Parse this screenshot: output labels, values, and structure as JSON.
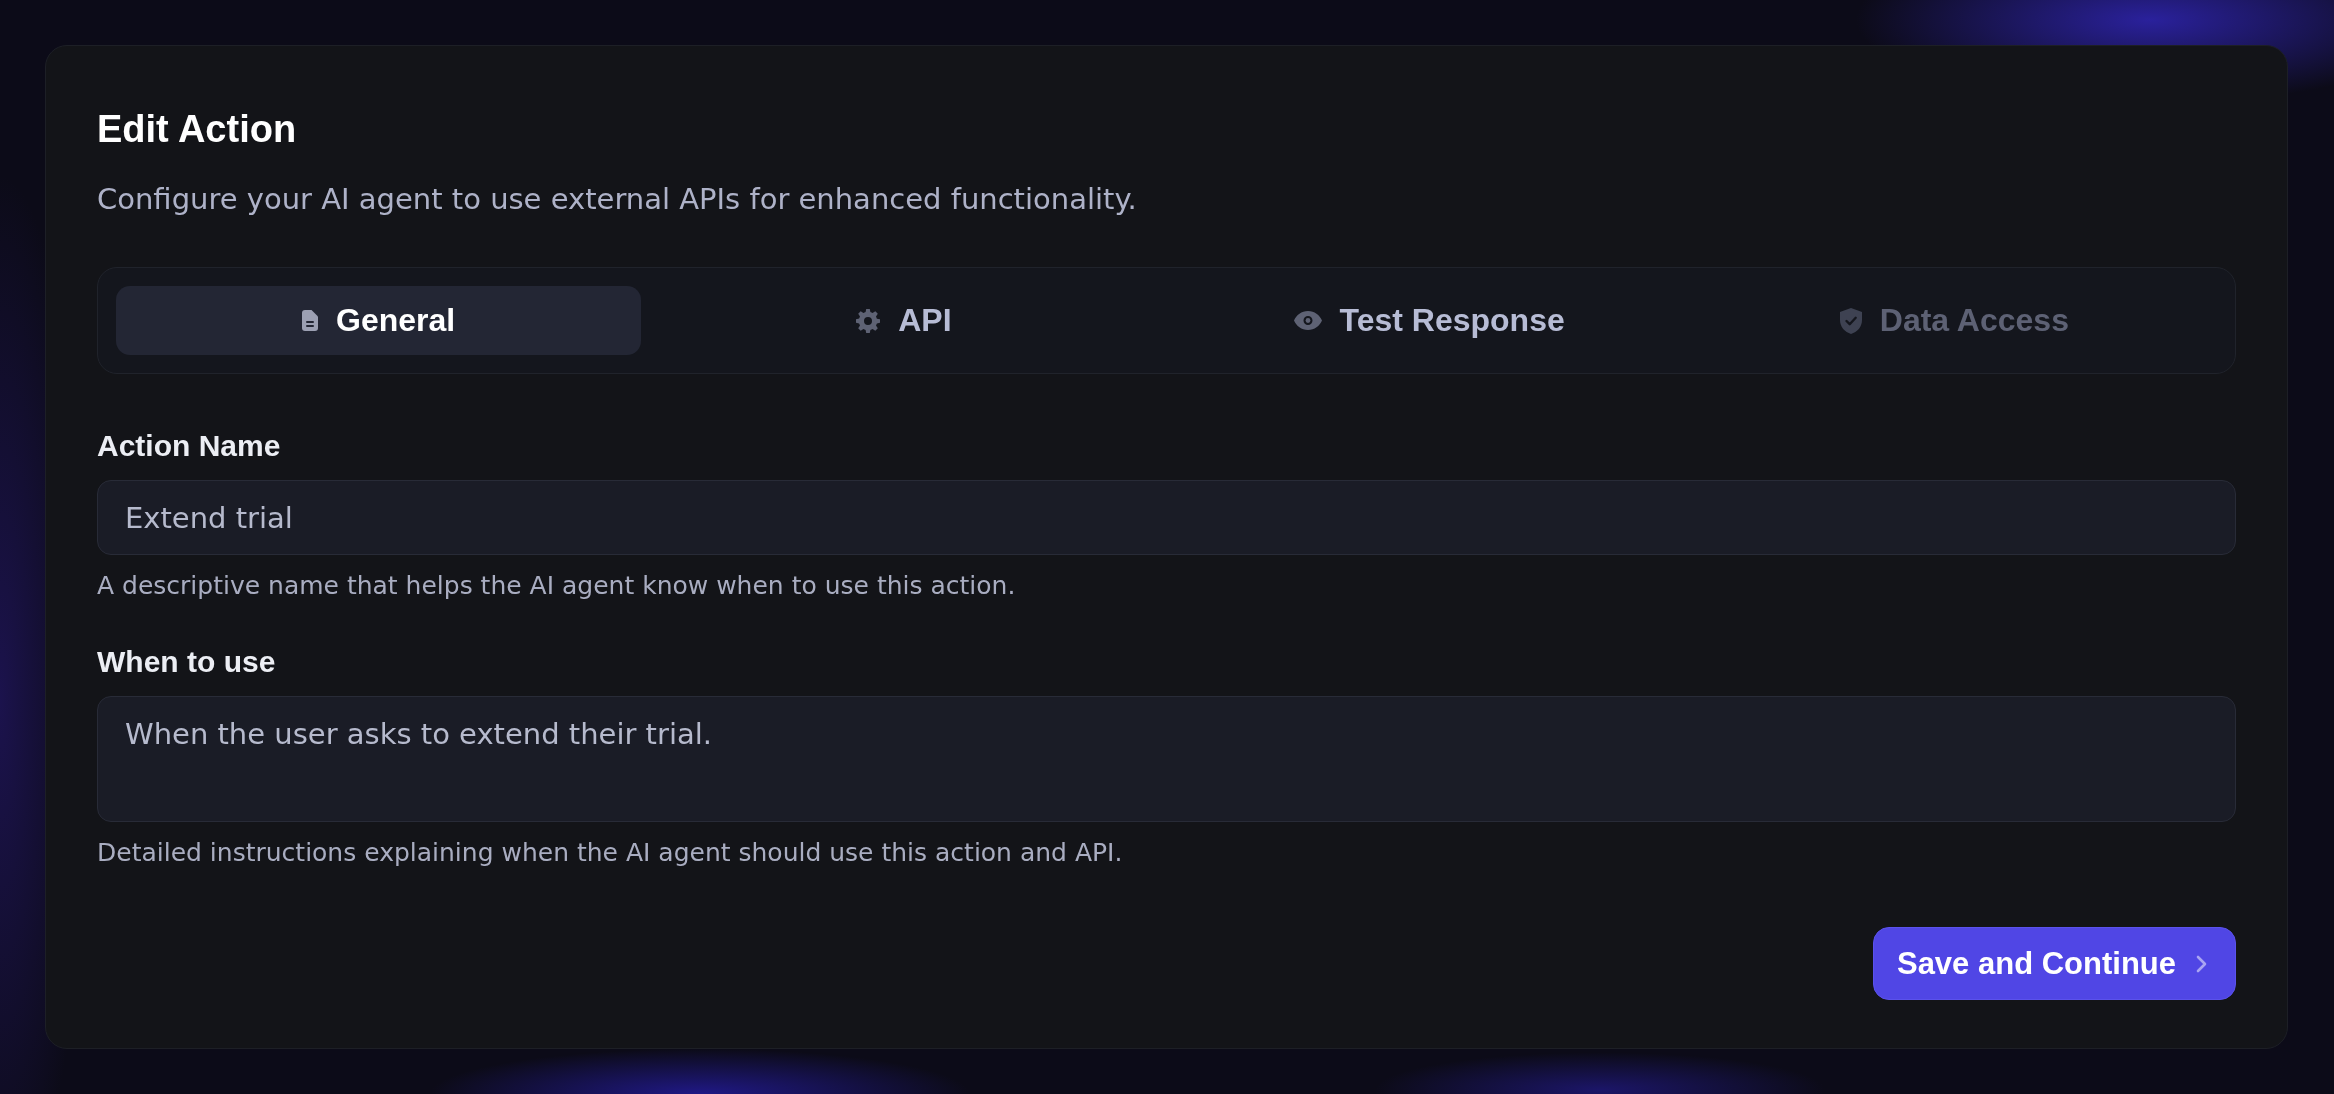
{
  "dialog": {
    "title": "Edit Action",
    "subtitle": "Configure your AI agent to use external APIs for enhanced functionality."
  },
  "tabs": [
    {
      "label": "General",
      "selected": true,
      "disabled": false
    },
    {
      "label": "API",
      "selected": false,
      "disabled": false
    },
    {
      "label": "Test Response",
      "selected": false,
      "disabled": false
    },
    {
      "label": "Data Access",
      "selected": false,
      "disabled": true
    }
  ],
  "fields": [
    {
      "kind": "input",
      "label": "Action Name",
      "value": "Extend trial",
      "help": "A descriptive name that helps the AI agent know when to use this action."
    },
    {
      "kind": "textarea",
      "label": "When to use",
      "value": "When the user asks to extend their trial.",
      "help": "Detailed instructions explaining when the AI agent should use this action and API."
    }
  ],
  "primary_button": {
    "label": "Save and Continue"
  }
}
